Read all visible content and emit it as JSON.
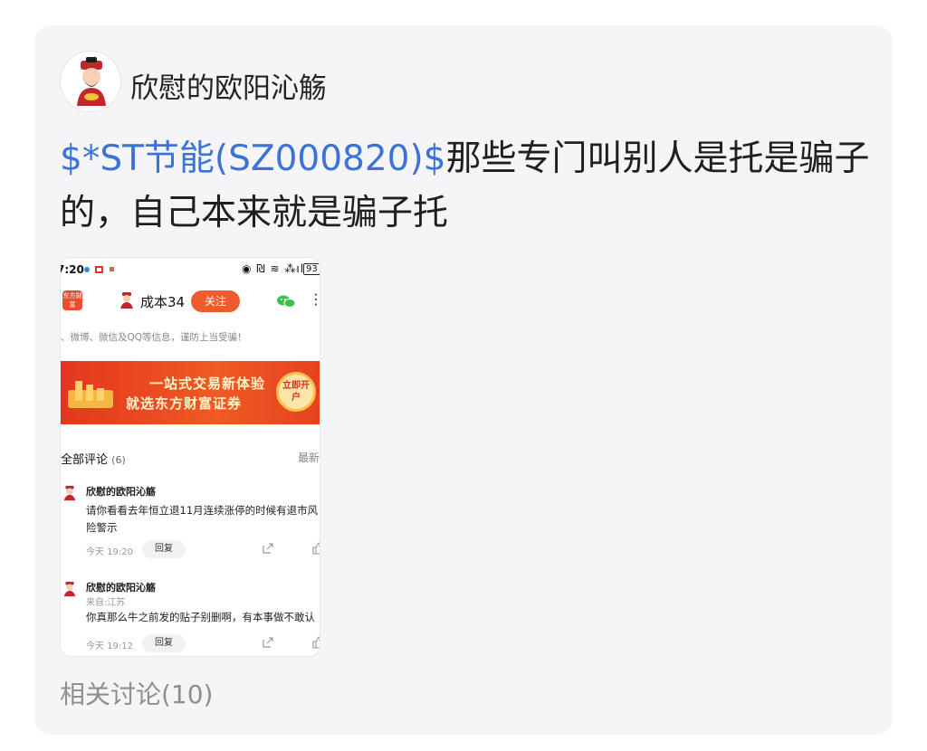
{
  "post": {
    "author": "欣慰的欧阳沁觞",
    "stock_tag": "$*ST节能(SZ000820)$",
    "text_rest": "那些专门叫别人是托是骗子的，自己本来就是骗子托"
  },
  "screenshot": {
    "status_time": "7:20",
    "status_right": "◉ ₪ ≋ ⁂ıl",
    "battery": "93",
    "app_logo": "东方财富",
    "header_name": "成本34",
    "follow_label": "关注",
    "notice": "、微博、微信及QQ等信息，谨防上当受骗！",
    "banner": {
      "line1": "一站式交易新体验",
      "line2": "就选东方财富证券",
      "cta": "立即开户"
    },
    "comments_title": "全部评论",
    "comments_count": "(6)",
    "sort_label": "最新",
    "comments": [
      {
        "name": "欣慰的欧阳沁觞",
        "location": "",
        "body": "请你看看去年恒立退11月连续涨停的时候有退市风险警示",
        "time": "今天 19:20",
        "reply": "回复"
      },
      {
        "name": "欣慰的欧阳沁觞",
        "location": "来自:江苏",
        "body": "你真那么牛之前发的贴子别删啊，有本事做不敢认",
        "time": "今天 19:12",
        "reply": "回复"
      }
    ]
  },
  "related": "相关讨论(10)",
  "colors": {
    "stock_link": "#3b73d8",
    "follow": "#ee5b2c",
    "card_bg": "#f5f5f8"
  }
}
